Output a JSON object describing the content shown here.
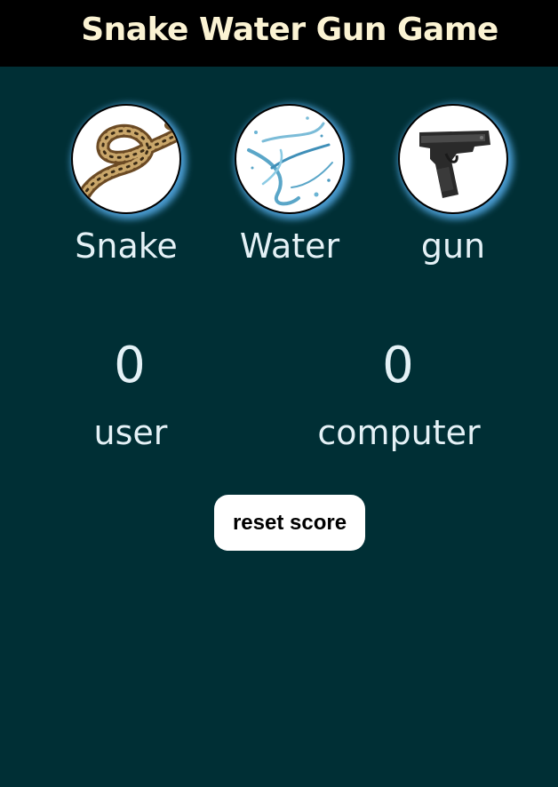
{
  "header": {
    "title": "Snake Water Gun Game"
  },
  "choices": [
    {
      "label": "Snake",
      "icon": "snake-icon"
    },
    {
      "label": "Water",
      "icon": "water-splash-icon"
    },
    {
      "label": "gun",
      "icon": "pistol-icon"
    }
  ],
  "scores": {
    "user": {
      "value": "0",
      "label": "user"
    },
    "computer": {
      "value": "0",
      "label": "computer"
    }
  },
  "reset_button": {
    "label": "reset score"
  },
  "colors": {
    "background": "#002f35",
    "header_background": "#000000",
    "title_text": "#fbf3d3",
    "text": "#e4f1f6",
    "glow": "#58b0ee",
    "button_background": "#ffffff"
  }
}
